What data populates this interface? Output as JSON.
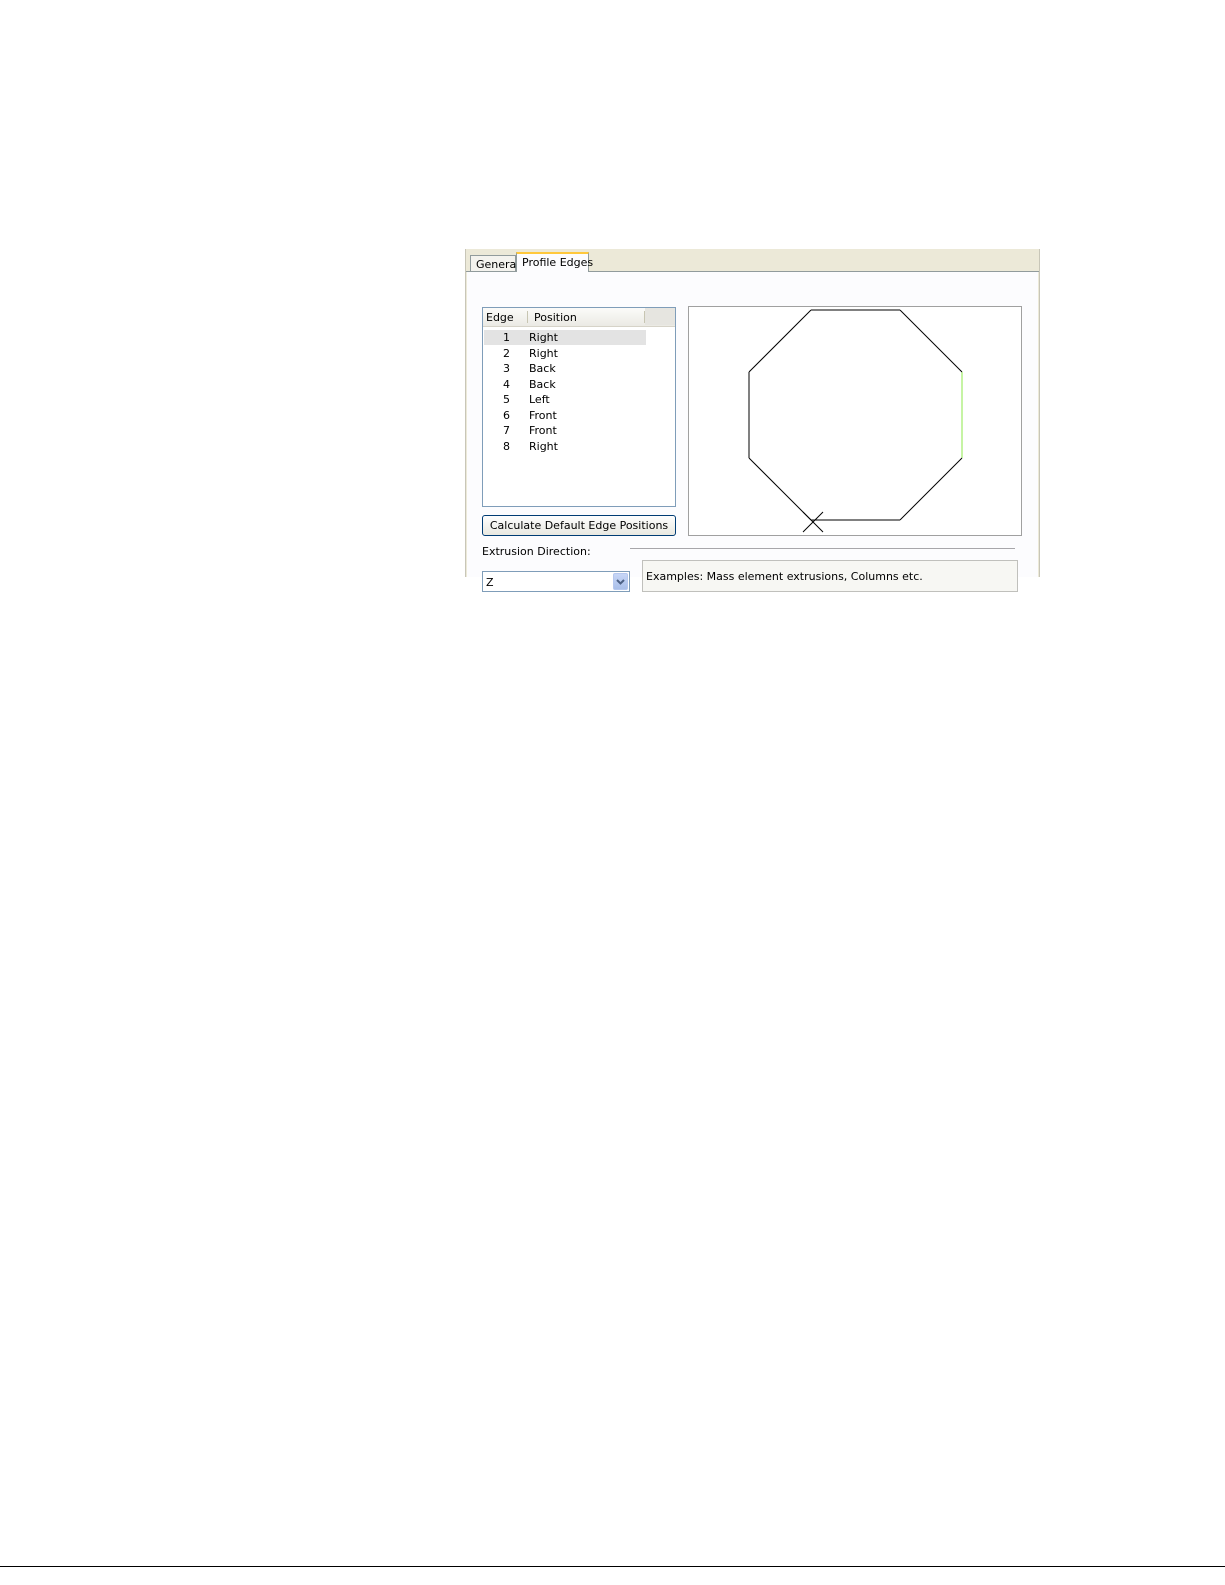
{
  "tabs": [
    {
      "label": "General",
      "active": false
    },
    {
      "label": "Profile Edges",
      "active": true
    }
  ],
  "edge_list": {
    "columns": [
      "Edge",
      "Position"
    ],
    "rows": [
      {
        "edge": "1",
        "position": "Right",
        "selected": true
      },
      {
        "edge": "2",
        "position": "Right",
        "selected": false
      },
      {
        "edge": "3",
        "position": "Back",
        "selected": false
      },
      {
        "edge": "4",
        "position": "Back",
        "selected": false
      },
      {
        "edge": "5",
        "position": "Left",
        "selected": false
      },
      {
        "edge": "6",
        "position": "Front",
        "selected": false
      },
      {
        "edge": "7",
        "position": "Front",
        "selected": false
      },
      {
        "edge": "8",
        "position": "Right",
        "selected": false
      }
    ]
  },
  "calculate_button_label": "Calculate Default Edge Positions",
  "extrusion": {
    "label": "Extrusion Direction:",
    "selected_value": "Z",
    "example_text": "Examples: Mass element extrusions, Columns etc."
  },
  "preview": {
    "shape": "octagon",
    "edge_color": "#000000",
    "highlight_color": "#8ee84a",
    "highlighted_edge": "1"
  }
}
